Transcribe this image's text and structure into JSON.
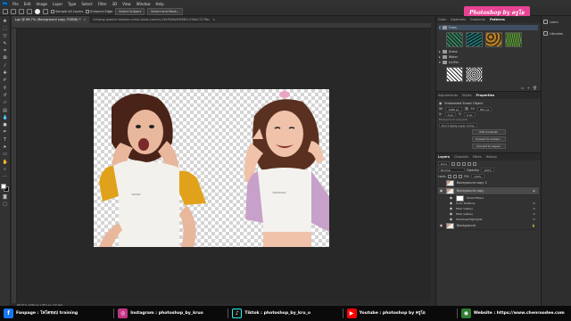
{
  "menu": {
    "app_badge": "Ps",
    "items": [
      "File",
      "Edit",
      "Image",
      "Layer",
      "Type",
      "Select",
      "Filter",
      "3D",
      "View",
      "Window",
      "Help"
    ]
  },
  "options_bar": {
    "sample_label": "Sample All Layers",
    "enhance_label": "Enhance Edge",
    "select_subject": "Select Subject",
    "select_mask": "Select and Mask..."
  },
  "watermark": "Photoshop by ครูโอ",
  "document_tabs": [
    {
      "label": "Lgu @ 66.7% (Background copy, RGB/8) *",
      "close": "×"
    },
    {
      "label": "blinpng-speech-balloon-comic-book-comics-56cf3e8a93f862c226e1717fbc",
      "close": "×"
    }
  ],
  "status_text": "66.67%   1280 px x 851 px (72 ppi)",
  "panels": {
    "tabs": [
      "Color",
      "Swatches",
      "Gradients",
      "Patterns"
    ],
    "active_tab": "Patterns",
    "pattern_folders": [
      {
        "name": "Trees",
        "expanded": true
      },
      {
        "name": "Grass",
        "expanded": false
      },
      {
        "name": "Water",
        "expanded": false
      },
      {
        "name": "sd-ffer",
        "expanded": true
      }
    ],
    "panel_buttons": [
      "▭",
      "+",
      "🗑"
    ]
  },
  "properties": {
    "tabs": [
      "Adjustments",
      "Styles",
      "Properties"
    ],
    "active_tab": "Properties",
    "kind": "Embedded Smart Object",
    "w_label": "W:",
    "w_value": "1280 px",
    "h_label": "H:",
    "h_value": "851 px",
    "x_label": "X:",
    "x_value": "0 px",
    "y_label": "Y:",
    "y_value": "0 px",
    "source_label": "Background copy.psb",
    "comp_label": "Don't Apply Layer Comp",
    "buttons": [
      "Edit Contents",
      "Convert to Linked...",
      "Convert to Layers"
    ]
  },
  "layers": {
    "tabs": [
      "Layers",
      "Channels",
      "Paths",
      "History"
    ],
    "active_tab": "Layers",
    "filter_label": "Kind",
    "blend_mode": "Normal",
    "opacity_label": "Opacity:",
    "opacity_value": "100%",
    "lock_label": "Lock:",
    "fill_label": "Fill:",
    "fill_value": "100%",
    "items": [
      {
        "name": "Background copy 2",
        "visible": false,
        "selected": false
      },
      {
        "name": "Background copy",
        "visible": true,
        "selected": true
      }
    ],
    "smart_filters_label": "Smart Filters",
    "filters": [
      "Color Halftone",
      "Filter Gallery",
      "Filter Gallery",
      "Shadows/Highlights"
    ],
    "background_name": "Background"
  },
  "right_strip": [
    {
      "label": "Learn"
    },
    {
      "label": "Libraries"
    }
  ],
  "bottom_bar": [
    {
      "icon": "f",
      "label": "Fanpage : โฟโตชอป training",
      "color": "#1877f2"
    },
    {
      "icon": "◎",
      "label": "Instagram : photoshop_by_kruo",
      "color": "#c13584"
    },
    {
      "icon": "♪",
      "label": "Tiktok : photoshop_by_kru_o",
      "color": "#111111"
    },
    {
      "icon": "▶",
      "label": "Youtube : photoshop by ครูโอ",
      "color": "#ff0000"
    },
    {
      "icon": "◉",
      "label": "Website : https://www.chenroodee.com",
      "color": "#2e7d32"
    }
  ],
  "colors": {
    "accent_blue": "#31a8ff",
    "watermark_pink": "#e84393"
  }
}
